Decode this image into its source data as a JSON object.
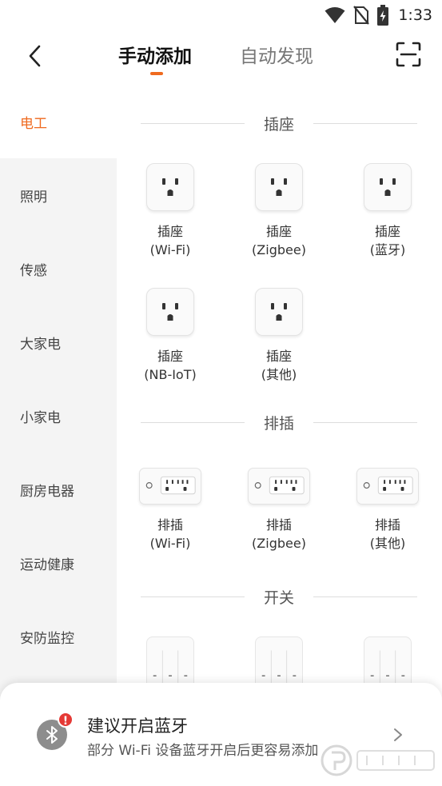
{
  "status_bar": {
    "time": "1:33",
    "icons": [
      "wifi-icon",
      "no-sim-icon",
      "battery-charging-icon"
    ]
  },
  "header": {
    "back_icon": "chevron-left-icon",
    "tabs": [
      {
        "label": "手动添加",
        "active": true
      },
      {
        "label": "自动发现",
        "active": false
      }
    ],
    "scan_icon": "scan-icon",
    "accent_color": "#ef6a1f"
  },
  "sidebar": {
    "items": [
      {
        "label": "电工",
        "active": true
      },
      {
        "label": "照明",
        "active": false
      },
      {
        "label": "传感",
        "active": false
      },
      {
        "label": "大家电",
        "active": false
      },
      {
        "label": "小家电",
        "active": false
      },
      {
        "label": "厨房电器",
        "active": false
      },
      {
        "label": "运动健康",
        "active": false
      },
      {
        "label": "安防监控",
        "active": false
      }
    ]
  },
  "sections": [
    {
      "title": "插座",
      "devices": [
        {
          "name": "插座",
          "variant": "(Wi-Fi)",
          "icon": "socket-icon"
        },
        {
          "name": "插座",
          "variant": "(Zigbee)",
          "icon": "socket-icon"
        },
        {
          "name": "插座",
          "variant": "(蓝牙)",
          "icon": "socket-icon"
        },
        {
          "name": "插座",
          "variant": "(NB-IoT)",
          "icon": "socket-icon"
        },
        {
          "name": "插座",
          "variant": "(其他)",
          "icon": "socket-icon"
        }
      ]
    },
    {
      "title": "排插",
      "devices": [
        {
          "name": "排插",
          "variant": "(Wi-Fi)",
          "icon": "power-strip-icon"
        },
        {
          "name": "排插",
          "variant": "(Zigbee)",
          "icon": "power-strip-icon"
        },
        {
          "name": "排插",
          "variant": "(其他)",
          "icon": "power-strip-icon"
        }
      ]
    },
    {
      "title": "开关",
      "devices": [
        {
          "icon": "wall-switch-icon"
        },
        {
          "icon": "wall-switch-icon"
        },
        {
          "icon": "wall-switch-icon"
        }
      ]
    }
  ],
  "bluetooth_prompt": {
    "icon": "bluetooth-icon",
    "badge": "!",
    "title": "建议开启蓝牙",
    "subtitle": "部分 Wi-Fi 设备蓝牙开启后更容易添加",
    "badge_color": "#e53935"
  }
}
